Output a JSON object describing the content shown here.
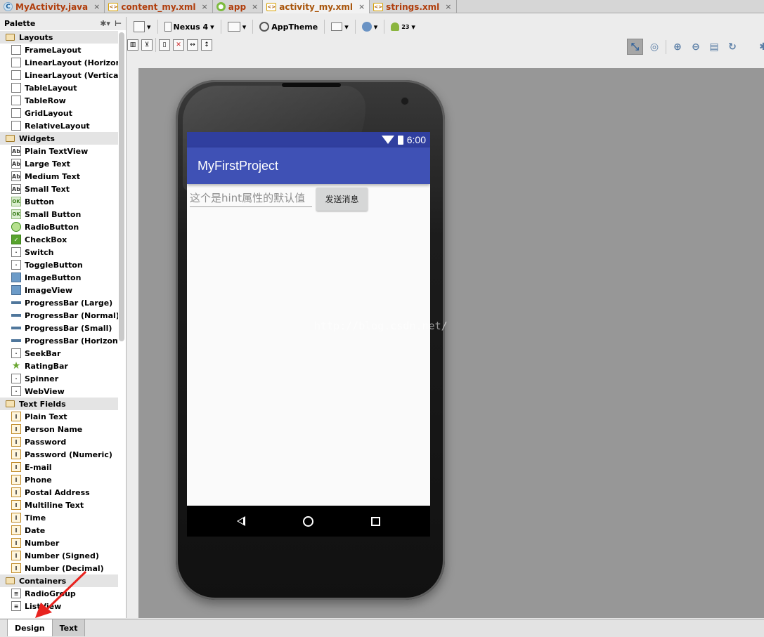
{
  "tabs": [
    {
      "label": "MyActivity.java",
      "icon": "java-class-icon"
    },
    {
      "label": "content_my.xml",
      "icon": "xml-file-icon"
    },
    {
      "label": "app",
      "icon": "android-module-icon"
    },
    {
      "label": "activity_my.xml",
      "icon": "xml-file-icon",
      "active": true
    },
    {
      "label": "strings.xml",
      "icon": "xml-file-icon"
    }
  ],
  "close_glyph": "×",
  "palette": {
    "title": "Palette",
    "categories": [
      {
        "label": "Layouts",
        "items": [
          "FrameLayout",
          "LinearLayout (Horizonta",
          "LinearLayout (Vertical)",
          "TableLayout",
          "TableRow",
          "GridLayout",
          "RelativeLayout"
        ]
      },
      {
        "label": "Widgets",
        "items": [
          "Plain TextView",
          "Large Text",
          "Medium Text",
          "Small Text",
          "Button",
          "Small Button",
          "RadioButton",
          "CheckBox",
          "Switch",
          "ToggleButton",
          "ImageButton",
          "ImageView",
          "ProgressBar (Large)",
          "ProgressBar (Normal)",
          "ProgressBar (Small)",
          "ProgressBar (Horizontal",
          "SeekBar",
          "RatingBar",
          "Spinner",
          "WebView"
        ]
      },
      {
        "label": "Text Fields",
        "items": [
          "Plain Text",
          "Person Name",
          "Password",
          "Password (Numeric)",
          "E-mail",
          "Phone",
          "Postal Address",
          "Multiline Text",
          "Time",
          "Date",
          "Number",
          "Number (Signed)",
          "Number (Decimal)"
        ]
      },
      {
        "label": "Containers",
        "items": [
          "RadioGroup",
          "ListView"
        ]
      }
    ]
  },
  "toolbar": {
    "device": "Nexus 4",
    "theme": "AppTheme",
    "api": "23"
  },
  "phone": {
    "time": "6:00",
    "app_title": "MyFirstProject",
    "hint": "这个是hint属性的默认值",
    "button_label": "发送消息"
  },
  "watermark": "http://blog.csdn.net/",
  "bottom_tabs": {
    "design": "Design",
    "text": "Text"
  },
  "colors": {
    "primary": "#3f51b5",
    "primary_dark": "#303f9f",
    "canvas": "#979797"
  }
}
